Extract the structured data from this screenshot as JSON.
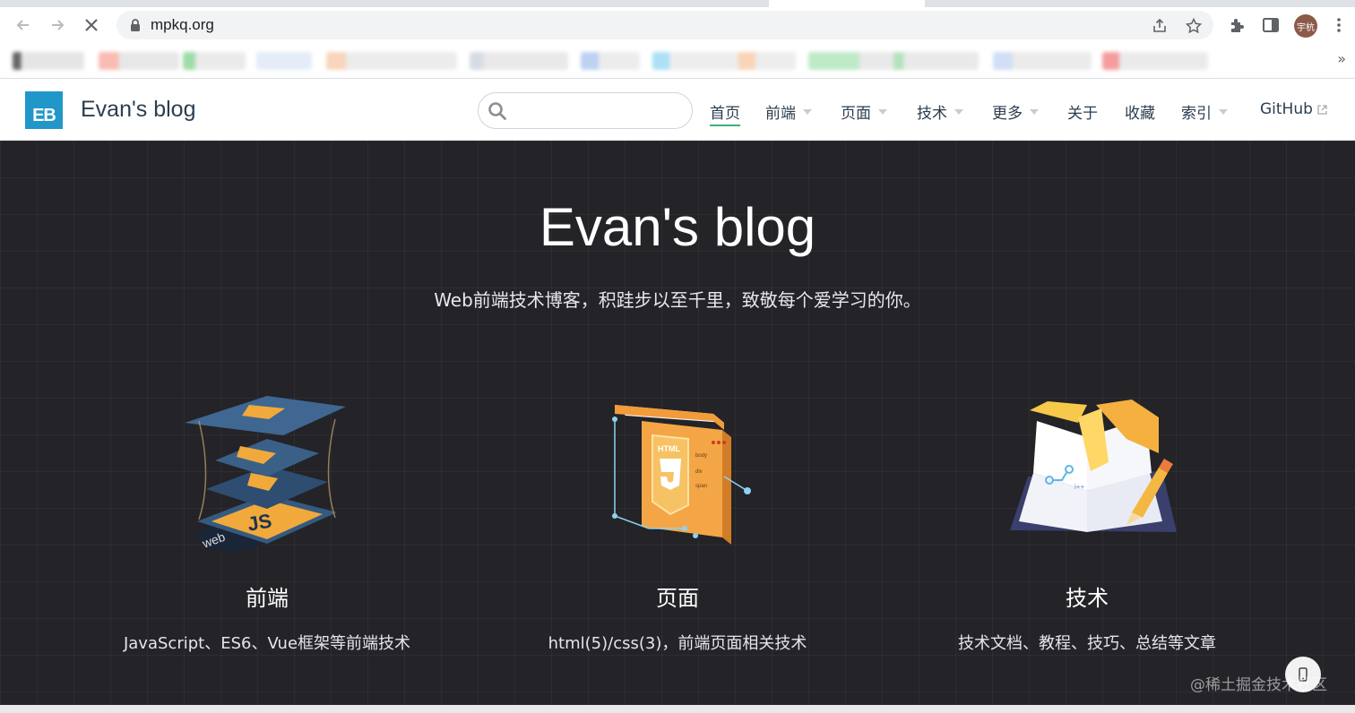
{
  "browser": {
    "url": "mpkq.org",
    "avatar_label": "宇杭",
    "colors": {
      "toolbar": "#ffffff",
      "omnibox": "#f1f3f4"
    }
  },
  "site": {
    "name": "Evan's blog",
    "logo_text": "EB",
    "search": {
      "value": "",
      "placeholder": ""
    },
    "nav": [
      {
        "label": "首页",
        "active": true,
        "dropdown": false
      },
      {
        "label": "前端",
        "active": false,
        "dropdown": true
      },
      {
        "label": "页面",
        "active": false,
        "dropdown": true
      },
      {
        "label": "技术",
        "active": false,
        "dropdown": true
      },
      {
        "label": "更多",
        "active": false,
        "dropdown": true
      },
      {
        "label": "关于",
        "active": false,
        "dropdown": false
      },
      {
        "label": "收藏",
        "active": false,
        "dropdown": false
      },
      {
        "label": "索引",
        "active": false,
        "dropdown": true
      },
      {
        "label": "GitHub",
        "active": false,
        "dropdown": false,
        "external": true
      }
    ],
    "colors": {
      "accent": "#3eaf7c",
      "logo": "#2196c9",
      "text": "#2c3e50",
      "hero_bg": "#232328"
    }
  },
  "hero": {
    "title": "Evan's blog",
    "description": "Web前端技术博客，积跬步以至千里，致敬每个爱学习的你。",
    "features": [
      {
        "title": "前端",
        "description": "JavaScript、ES6、Vue框架等前端技术",
        "icon": "js-layers-illustration"
      },
      {
        "title": "页面",
        "description": "html(5)/css(3)，前端页面相关技术",
        "icon": "html5-illustration"
      },
      {
        "title": "技术",
        "description": "技术文档、教程、技巧、总结等文章",
        "icon": "book-pencil-illustration"
      }
    ]
  },
  "watermark": "@稀土掘金技术社区"
}
